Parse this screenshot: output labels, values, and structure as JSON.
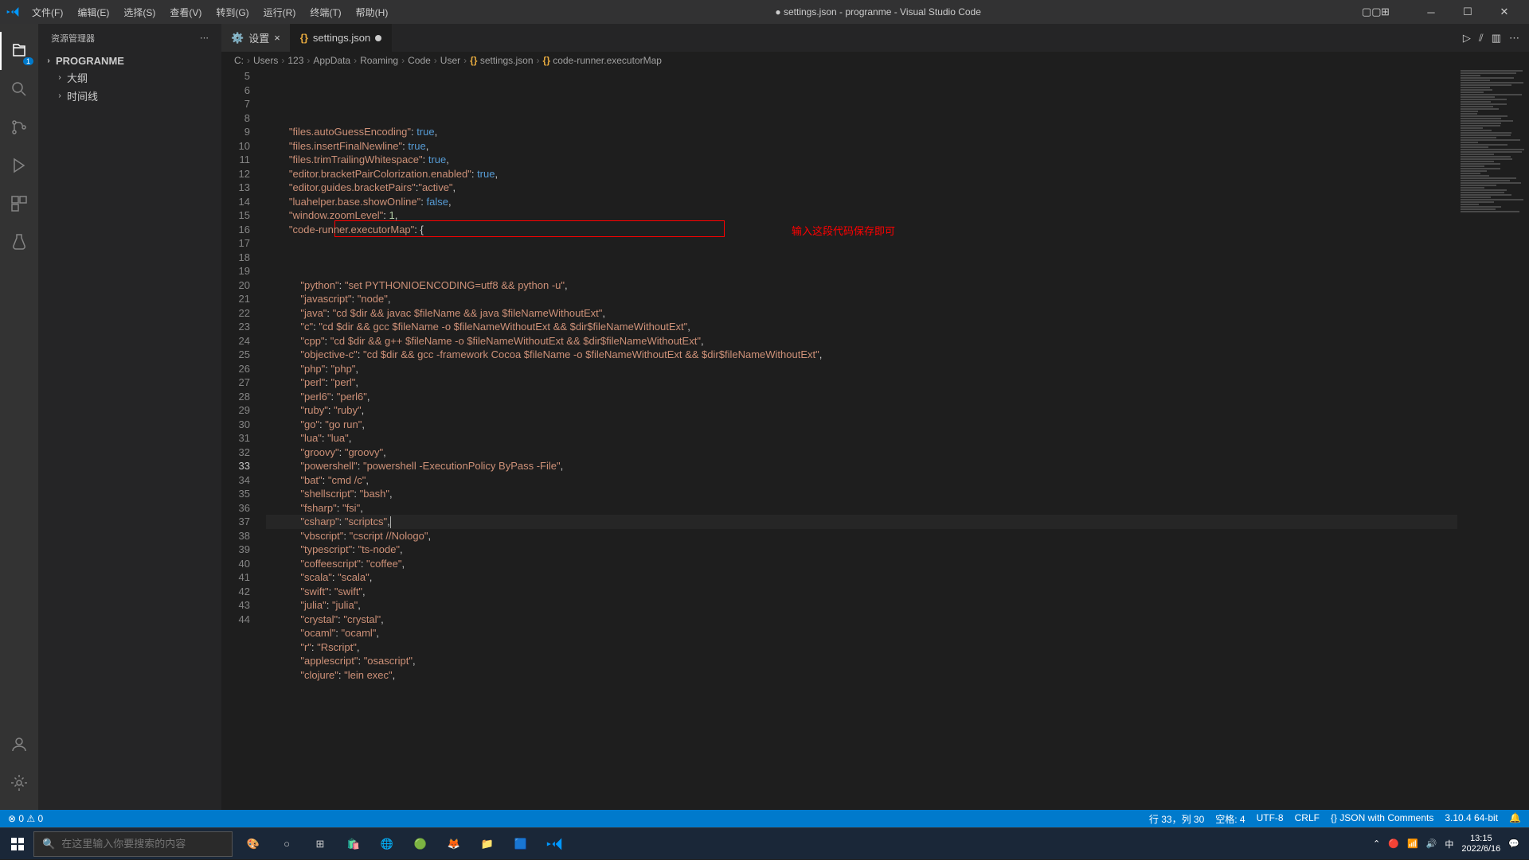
{
  "titlebar": {
    "menus": [
      "文件(F)",
      "编辑(E)",
      "选择(S)",
      "查看(V)",
      "转到(G)",
      "运行(R)",
      "终端(T)",
      "帮助(H)"
    ],
    "title": "● settings.json - progranme - Visual Studio Code"
  },
  "sidebar": {
    "header": "资源管理器",
    "project": "PROGRANME",
    "items": [
      "大纲",
      "时间线"
    ]
  },
  "tabs": [
    {
      "icon": "gear",
      "label": "设置"
    },
    {
      "icon": "braces",
      "label": "settings.json",
      "modified": true,
      "active": true
    }
  ],
  "breadcrumb": [
    "C:",
    "Users",
    "123",
    "AppData",
    "Roaming",
    "Code",
    "User",
    "settings.json",
    "code-runner.executorMap"
  ],
  "annotation": "输入这段代码保存即可",
  "lines": [
    {
      "num": 5,
      "tokens": [
        [
          "p",
          "        "
        ],
        [
          "s",
          "\"files.autoGuessEncoding\""
        ],
        [
          "p",
          ": "
        ],
        [
          "b",
          "true"
        ],
        [
          "p",
          ","
        ]
      ]
    },
    {
      "num": 6,
      "tokens": [
        [
          "p",
          "        "
        ],
        [
          "s",
          "\"files.insertFinalNewline\""
        ],
        [
          "p",
          ": "
        ],
        [
          "b",
          "true"
        ],
        [
          "p",
          ","
        ]
      ]
    },
    {
      "num": 7,
      "tokens": [
        [
          "p",
          "        "
        ],
        [
          "s",
          "\"files.trimTrailingWhitespace\""
        ],
        [
          "p",
          ": "
        ],
        [
          "b",
          "true"
        ],
        [
          "p",
          ","
        ]
      ]
    },
    {
      "num": 8,
      "tokens": [
        [
          "p",
          "        "
        ],
        [
          "s",
          "\"editor.bracketPairColorization.enabled\""
        ],
        [
          "p",
          ": "
        ],
        [
          "b",
          "true"
        ],
        [
          "p",
          ","
        ]
      ]
    },
    {
      "num": 9,
      "tokens": [
        [
          "p",
          "        "
        ],
        [
          "s",
          "\"editor.guides.bracketPairs\""
        ],
        [
          "p",
          ":"
        ],
        [
          "s",
          "\"active\""
        ],
        [
          "p",
          ","
        ]
      ]
    },
    {
      "num": 10,
      "tokens": [
        [
          "p",
          "        "
        ],
        [
          "s",
          "\"luahelper.base.showOnline\""
        ],
        [
          "p",
          ": "
        ],
        [
          "b",
          "false"
        ],
        [
          "p",
          ","
        ]
      ]
    },
    {
      "num": 11,
      "tokens": [
        [
          "p",
          "        "
        ],
        [
          "s",
          "\"window.zoomLevel\""
        ],
        [
          "p",
          ": "
        ],
        [
          "n",
          "1"
        ],
        [
          "p",
          ","
        ]
      ]
    },
    {
      "num": 12,
      "tokens": [
        [
          "p",
          "        "
        ],
        [
          "s",
          "\"code-runner.executorMap\""
        ],
        [
          "p",
          ": {"
        ]
      ]
    },
    {
      "num": 13,
      "tokens": [
        [
          "p",
          ""
        ]
      ]
    },
    {
      "num": 14,
      "tokens": [
        [
          "p",
          ""
        ]
      ]
    },
    {
      "num": 15,
      "tokens": [
        [
          "p",
          ""
        ]
      ]
    },
    {
      "num": 16,
      "tokens": [
        [
          "p",
          "            "
        ],
        [
          "s",
          "\"python\""
        ],
        [
          "p",
          ": "
        ],
        [
          "s",
          "\"set PYTHONIOENCODING=utf8 && python -u\""
        ],
        [
          "p",
          ","
        ]
      ],
      "highlight": true
    },
    {
      "num": 17,
      "tokens": [
        [
          "p",
          "            "
        ],
        [
          "s",
          "\"javascript\""
        ],
        [
          "p",
          ": "
        ],
        [
          "s",
          "\"node\""
        ],
        [
          "p",
          ","
        ]
      ]
    },
    {
      "num": 18,
      "tokens": [
        [
          "p",
          "            "
        ],
        [
          "s",
          "\"java\""
        ],
        [
          "p",
          ": "
        ],
        [
          "s",
          "\"cd $dir && javac $fileName && java $fileNameWithoutExt\""
        ],
        [
          "p",
          ","
        ]
      ]
    },
    {
      "num": 19,
      "tokens": [
        [
          "p",
          "            "
        ],
        [
          "s",
          "\"c\""
        ],
        [
          "p",
          ": "
        ],
        [
          "s",
          "\"cd $dir && gcc $fileName -o $fileNameWithoutExt && $dir$fileNameWithoutExt\""
        ],
        [
          "p",
          ","
        ]
      ]
    },
    {
      "num": 20,
      "tokens": [
        [
          "p",
          "            "
        ],
        [
          "s",
          "\"cpp\""
        ],
        [
          "p",
          ": "
        ],
        [
          "s",
          "\"cd $dir && g++ $fileName -o $fileNameWithoutExt && $dir$fileNameWithoutExt\""
        ],
        [
          "p",
          ","
        ]
      ]
    },
    {
      "num": 21,
      "tokens": [
        [
          "p",
          "            "
        ],
        [
          "s",
          "\"objective-c\""
        ],
        [
          "p",
          ": "
        ],
        [
          "s",
          "\"cd $dir && gcc -framework Cocoa $fileName -o $fileNameWithoutExt && $dir$fileNameWithoutExt\""
        ],
        [
          "p",
          ","
        ]
      ]
    },
    {
      "num": 22,
      "tokens": [
        [
          "p",
          "            "
        ],
        [
          "s",
          "\"php\""
        ],
        [
          "p",
          ": "
        ],
        [
          "s",
          "\"php\""
        ],
        [
          "p",
          ","
        ]
      ]
    },
    {
      "num": 23,
      "tokens": [
        [
          "p",
          "            "
        ],
        [
          "s",
          "\"perl\""
        ],
        [
          "p",
          ": "
        ],
        [
          "s",
          "\"perl\""
        ],
        [
          "p",
          ","
        ]
      ]
    },
    {
      "num": 24,
      "tokens": [
        [
          "p",
          "            "
        ],
        [
          "s",
          "\"perl6\""
        ],
        [
          "p",
          ": "
        ],
        [
          "s",
          "\"perl6\""
        ],
        [
          "p",
          ","
        ]
      ]
    },
    {
      "num": 25,
      "tokens": [
        [
          "p",
          "            "
        ],
        [
          "s",
          "\"ruby\""
        ],
        [
          "p",
          ": "
        ],
        [
          "s",
          "\"ruby\""
        ],
        [
          "p",
          ","
        ]
      ]
    },
    {
      "num": 26,
      "tokens": [
        [
          "p",
          "            "
        ],
        [
          "s",
          "\"go\""
        ],
        [
          "p",
          ": "
        ],
        [
          "s",
          "\"go run\""
        ],
        [
          "p",
          ","
        ]
      ]
    },
    {
      "num": 27,
      "tokens": [
        [
          "p",
          "            "
        ],
        [
          "s",
          "\"lua\""
        ],
        [
          "p",
          ": "
        ],
        [
          "s",
          "\"lua\""
        ],
        [
          "p",
          ","
        ]
      ]
    },
    {
      "num": 28,
      "tokens": [
        [
          "p",
          "            "
        ],
        [
          "s",
          "\"groovy\""
        ],
        [
          "p",
          ": "
        ],
        [
          "s",
          "\"groovy\""
        ],
        [
          "p",
          ","
        ]
      ]
    },
    {
      "num": 29,
      "tokens": [
        [
          "p",
          "            "
        ],
        [
          "s",
          "\"powershell\""
        ],
        [
          "p",
          ": "
        ],
        [
          "s",
          "\"powershell -ExecutionPolicy ByPass -File\""
        ],
        [
          "p",
          ","
        ]
      ]
    },
    {
      "num": 30,
      "tokens": [
        [
          "p",
          "            "
        ],
        [
          "s",
          "\"bat\""
        ],
        [
          "p",
          ": "
        ],
        [
          "s",
          "\"cmd /c\""
        ],
        [
          "p",
          ","
        ]
      ]
    },
    {
      "num": 31,
      "tokens": [
        [
          "p",
          "            "
        ],
        [
          "s",
          "\"shellscript\""
        ],
        [
          "p",
          ": "
        ],
        [
          "s",
          "\"bash\""
        ],
        [
          "p",
          ","
        ]
      ]
    },
    {
      "num": 32,
      "tokens": [
        [
          "p",
          "            "
        ],
        [
          "s",
          "\"fsharp\""
        ],
        [
          "p",
          ": "
        ],
        [
          "s",
          "\"fsi\""
        ],
        [
          "p",
          ","
        ]
      ]
    },
    {
      "num": 33,
      "tokens": [
        [
          "p",
          "            "
        ],
        [
          "s",
          "\"csharp\""
        ],
        [
          "p",
          ": "
        ],
        [
          "s",
          "\"scriptcs\""
        ],
        [
          "p",
          ","
        ]
      ],
      "active": true,
      "cursor": true
    },
    {
      "num": 34,
      "tokens": [
        [
          "p",
          "            "
        ],
        [
          "s",
          "\"vbscript\""
        ],
        [
          "p",
          ": "
        ],
        [
          "s",
          "\"cscript //Nologo\""
        ],
        [
          "p",
          ","
        ]
      ]
    },
    {
      "num": 35,
      "tokens": [
        [
          "p",
          "            "
        ],
        [
          "s",
          "\"typescript\""
        ],
        [
          "p",
          ": "
        ],
        [
          "s",
          "\"ts-node\""
        ],
        [
          "p",
          ","
        ]
      ]
    },
    {
      "num": 36,
      "tokens": [
        [
          "p",
          "            "
        ],
        [
          "s",
          "\"coffeescript\""
        ],
        [
          "p",
          ": "
        ],
        [
          "s",
          "\"coffee\""
        ],
        [
          "p",
          ","
        ]
      ]
    },
    {
      "num": 37,
      "tokens": [
        [
          "p",
          "            "
        ],
        [
          "s",
          "\"scala\""
        ],
        [
          "p",
          ": "
        ],
        [
          "s",
          "\"scala\""
        ],
        [
          "p",
          ","
        ]
      ]
    },
    {
      "num": 38,
      "tokens": [
        [
          "p",
          "            "
        ],
        [
          "s",
          "\"swift\""
        ],
        [
          "p",
          ": "
        ],
        [
          "s",
          "\"swift\""
        ],
        [
          "p",
          ","
        ]
      ]
    },
    {
      "num": 39,
      "tokens": [
        [
          "p",
          "            "
        ],
        [
          "s",
          "\"julia\""
        ],
        [
          "p",
          ": "
        ],
        [
          "s",
          "\"julia\""
        ],
        [
          "p",
          ","
        ]
      ]
    },
    {
      "num": 40,
      "tokens": [
        [
          "p",
          "            "
        ],
        [
          "s",
          "\"crystal\""
        ],
        [
          "p",
          ": "
        ],
        [
          "s",
          "\"crystal\""
        ],
        [
          "p",
          ","
        ]
      ]
    },
    {
      "num": 41,
      "tokens": [
        [
          "p",
          "            "
        ],
        [
          "s",
          "\"ocaml\""
        ],
        [
          "p",
          ": "
        ],
        [
          "s",
          "\"ocaml\""
        ],
        [
          "p",
          ","
        ]
      ]
    },
    {
      "num": 42,
      "tokens": [
        [
          "p",
          "            "
        ],
        [
          "s",
          "\"r\""
        ],
        [
          "p",
          ": "
        ],
        [
          "s",
          "\"Rscript\""
        ],
        [
          "p",
          ","
        ]
      ]
    },
    {
      "num": 43,
      "tokens": [
        [
          "p",
          "            "
        ],
        [
          "s",
          "\"applescript\""
        ],
        [
          "p",
          ": "
        ],
        [
          "s",
          "\"osascript\""
        ],
        [
          "p",
          ","
        ]
      ]
    },
    {
      "num": 44,
      "tokens": [
        [
          "p",
          "            "
        ],
        [
          "s",
          "\"clojure\""
        ],
        [
          "p",
          ": "
        ],
        [
          "s",
          "\"lein exec\""
        ],
        [
          "p",
          ","
        ]
      ]
    }
  ],
  "statusbar": {
    "left": [
      "⊗ 0 ⚠ 0"
    ],
    "right": [
      "行 33，列 30",
      "空格: 4",
      "UTF-8",
      "CRLF",
      "{} JSON with Comments",
      "3.10.4 64-bit",
      "🔔"
    ]
  },
  "taskbar": {
    "search_placeholder": "在这里输入你要搜索的内容",
    "time": "13:15",
    "date": "2022/6/16"
  }
}
